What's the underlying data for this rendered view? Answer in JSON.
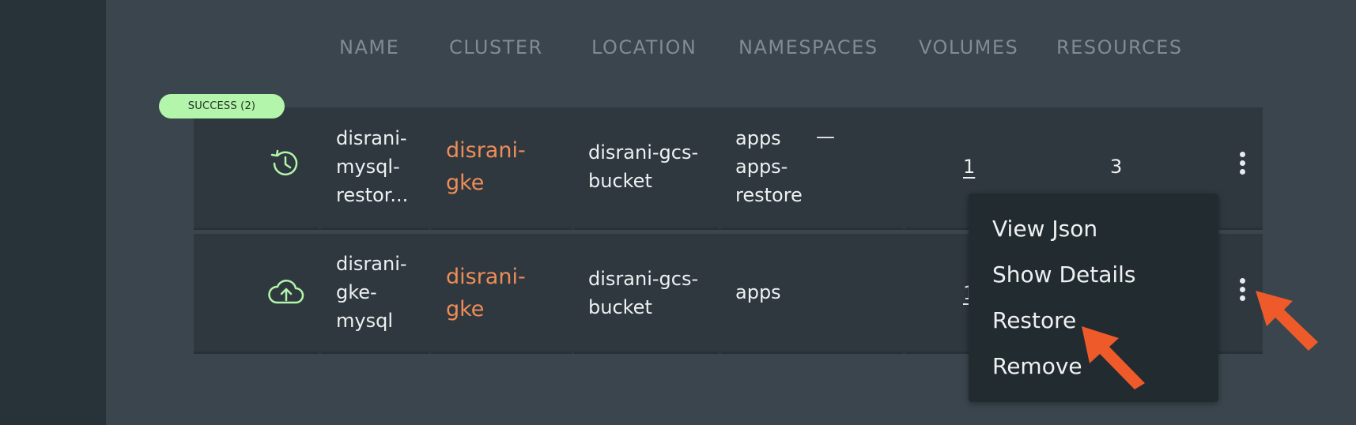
{
  "table": {
    "headers": [
      "NAME",
      "CLUSTER",
      "LOCATION",
      "NAMESPACES",
      "VOLUMES",
      "RESOURCES"
    ],
    "group_badge": "SUCCESS (2)",
    "rows": [
      {
        "icon": "restore-history-icon",
        "name_lines": [
          "disrani-",
          "mysql-",
          "restor..."
        ],
        "cluster_lines": [
          "disrani-",
          "gke"
        ],
        "location_lines": [
          "disrani-gcs-",
          "bucket"
        ],
        "namespace_lines": [
          "apps",
          "apps-",
          "restore"
        ],
        "extra": "—",
        "volumes": "1",
        "resources": "3"
      },
      {
        "icon": "cloud-upload-icon",
        "name_lines": [
          "disrani-",
          "gke-",
          "mysql"
        ],
        "cluster_lines": [
          "disrani-",
          "gke"
        ],
        "location_lines": [
          "disrani-gcs-",
          "bucket"
        ],
        "namespace_lines": [
          "apps"
        ],
        "volumes": "1"
      }
    ]
  },
  "context_menu": {
    "items": [
      "View Json",
      "Show Details",
      "Restore",
      "Remove"
    ]
  },
  "colors": {
    "accent_orange": "#ef8d57",
    "success_green": "#b3f5aa",
    "annotation_arrow": "#ee5a2a"
  }
}
